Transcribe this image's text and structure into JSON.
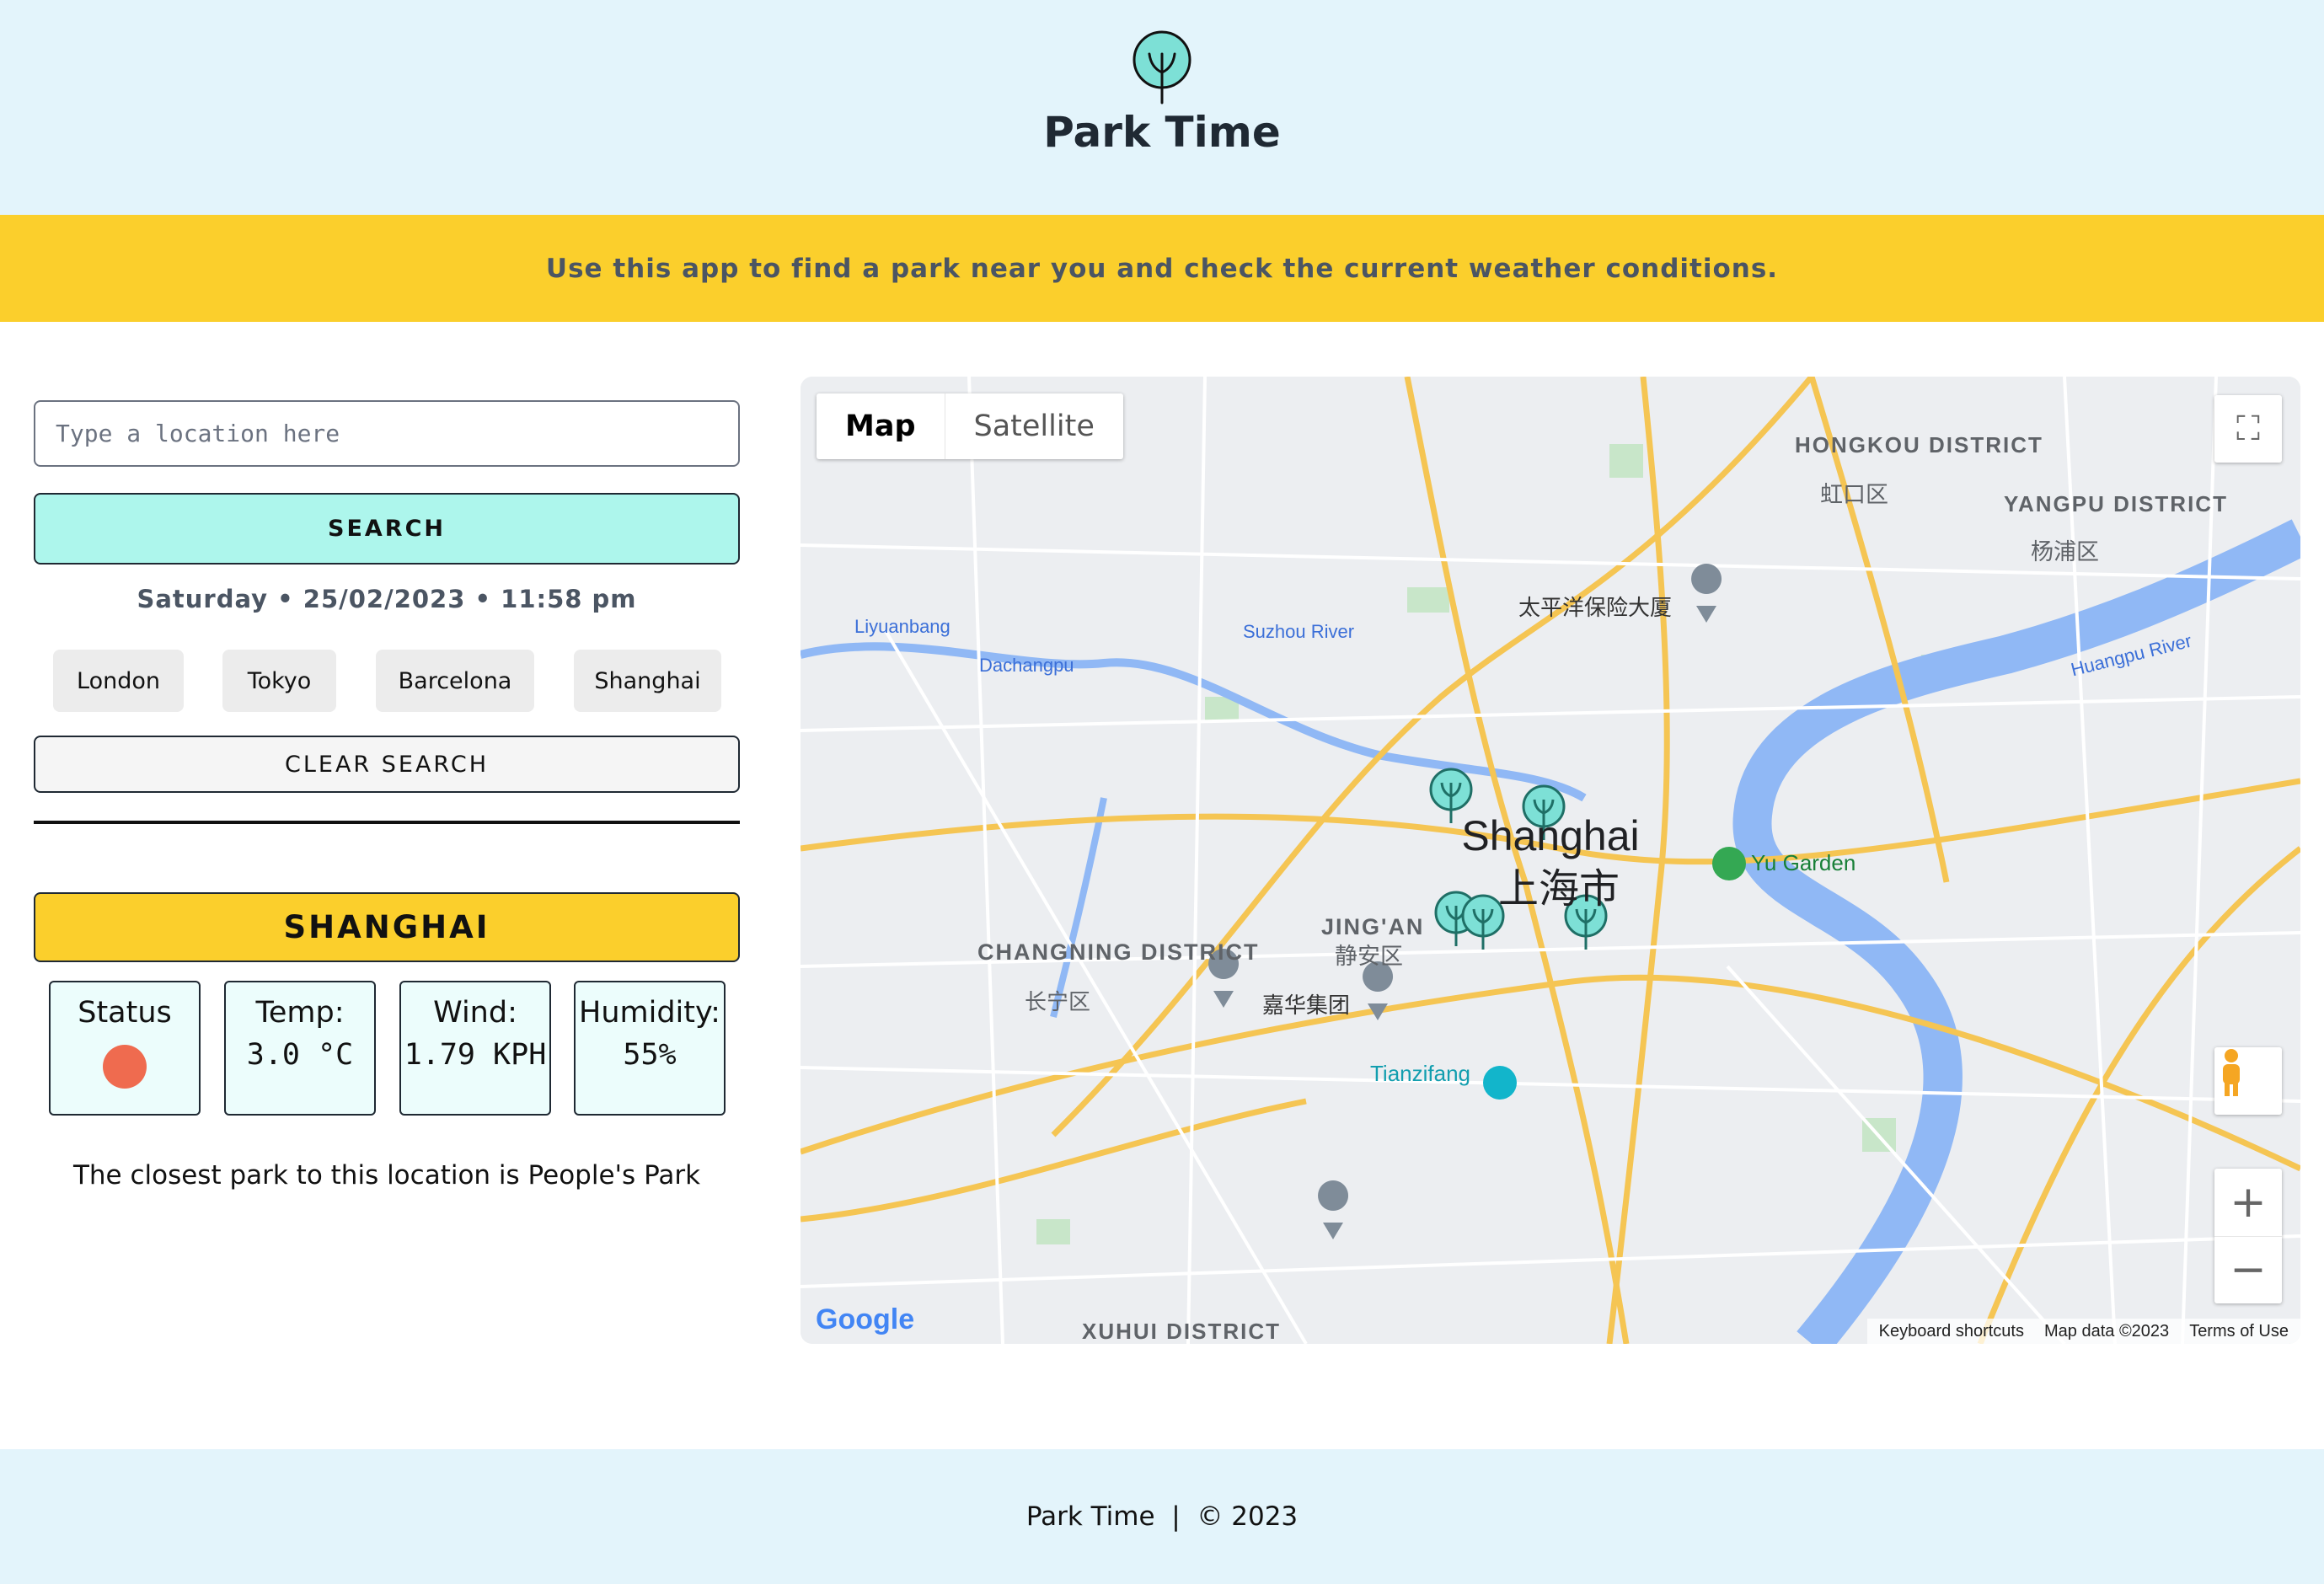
{
  "header": {
    "title": "Park Time"
  },
  "banner": {
    "text": "Use this app to find a park near you and check the current weather conditions."
  },
  "search": {
    "placeholder": "Type a location here",
    "button_label": "SEARCH"
  },
  "datetime": "Saturday • 25/02/2023 • 11:58 pm",
  "quick_cities": [
    "London",
    "Tokyo",
    "Barcelona",
    "Shanghai"
  ],
  "clear_label": "CLEAR SEARCH",
  "result": {
    "city": "SHANGHAI",
    "status_label": "Status",
    "temp_label": "Temp:",
    "temp_value": "3.0 °C",
    "wind_label": "Wind:",
    "wind_value": "1.79 KPH",
    "humidity_label": "Humidity:",
    "humidity_value": "55%",
    "closest_park": "The closest park to this location is People's Park"
  },
  "map": {
    "type_controls": [
      "Map",
      "Satellite"
    ],
    "city_label": "Shanghai",
    "city_label_cn": "上海市",
    "districts": [
      {
        "name": "CHANGNING DISTRICT",
        "cn": "长宁区"
      },
      {
        "name": "JING'AN",
        "cn": "静安区"
      },
      {
        "name": "HONGKOU DISTRICT",
        "cn": "虹口区"
      },
      {
        "name": "YANGPU DISTRICT",
        "cn": "杨浦区"
      },
      {
        "name": "XUHUI DISTRICT",
        "cn": ""
      }
    ],
    "places": [
      "Yu Garden",
      "Tianzifang",
      "Suzhou River",
      "Huangpu River",
      "Liyuanbang",
      "Dachangpu",
      "太平洋保险大厦",
      "嘉华集团"
    ],
    "attribution": [
      "Keyboard shortcuts",
      "Map data ©2023",
      "Terms of Use"
    ],
    "google_logo": "Google",
    "accent_color": "#7de0d6"
  },
  "footer": {
    "text": "Park Time  |  © 2023"
  },
  "colors": {
    "header_bg": "#e3f4fb",
    "banner_bg": "#fbcf2c",
    "search_btn": "#adf6ec",
    "status_dot": "#ef6b4f"
  }
}
